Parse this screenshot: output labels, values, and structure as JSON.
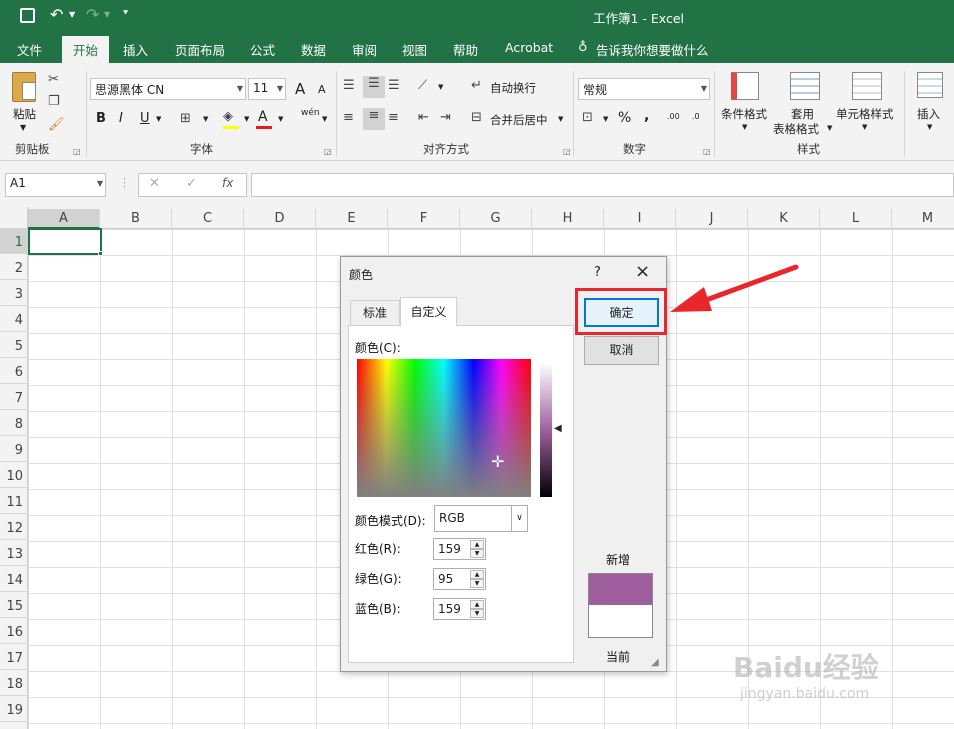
{
  "app": {
    "window_title": "工作簿1 - Excel",
    "accent": "#217346"
  },
  "tabs": [
    "文件",
    "开始",
    "插入",
    "页面布局",
    "公式",
    "数据",
    "审阅",
    "视图",
    "帮助",
    "Acrobat"
  ],
  "tell_me": "告诉我你想要做什么",
  "ribbon": {
    "clipboard": {
      "paste": "粘贴",
      "group": "剪贴板"
    },
    "font": {
      "name": "思源黑体 CN",
      "size": "11",
      "bold": "B",
      "italic": "I",
      "underline": "U",
      "grow": "A",
      "shrink": "A",
      "phonetic": "wén",
      "group": "字体"
    },
    "align": {
      "wrap": "自动换行",
      "merge": "合并后居中",
      "group": "对齐方式"
    },
    "number": {
      "format": "常规",
      "percent": "%",
      "comma": ",",
      "inc_dec": ".00",
      "dec_dec": ".0",
      "group": "数字"
    },
    "styles": {
      "cond": "条件格式",
      "table1": "套用",
      "table2": "表格格式",
      "cell": "单元格样式",
      "group": "样式"
    },
    "cells": {
      "insert": "插入"
    }
  },
  "formula_bar": {
    "name_box": "A1",
    "fx": "fx",
    "value": ""
  },
  "sheet": {
    "columns": [
      "A",
      "B",
      "C",
      "D",
      "E",
      "F",
      "G",
      "H",
      "I",
      "J",
      "K",
      "L",
      "M"
    ],
    "rows": [
      "1",
      "2",
      "3",
      "4",
      "5",
      "6",
      "7",
      "8",
      "9",
      "10",
      "11",
      "12",
      "13",
      "14",
      "15",
      "16",
      "17",
      "18",
      "19"
    ],
    "selected_cell": "A1"
  },
  "dialog": {
    "title": "颜色",
    "help": "?",
    "close": "×",
    "tabs": [
      "标准",
      "自定义"
    ],
    "active_tab": "自定义",
    "colors_label": "颜色(C):",
    "model_label": "颜色模式(D):",
    "model_value": "RGB",
    "red_label": "红色(R):",
    "green_label": "绿色(G):",
    "blue_label": "蓝色(B):",
    "red": "159",
    "green": "95",
    "blue": "159",
    "ok": "确定",
    "cancel": "取消",
    "new_label": "新增",
    "current_label": "当前",
    "new_color": "#9f5f9f",
    "current_color": "#ffffff"
  },
  "annotation": {
    "highlight_color": "#e8262b"
  },
  "watermark": {
    "text": "Baidu经验",
    "url": "jingyan.baidu.com"
  }
}
